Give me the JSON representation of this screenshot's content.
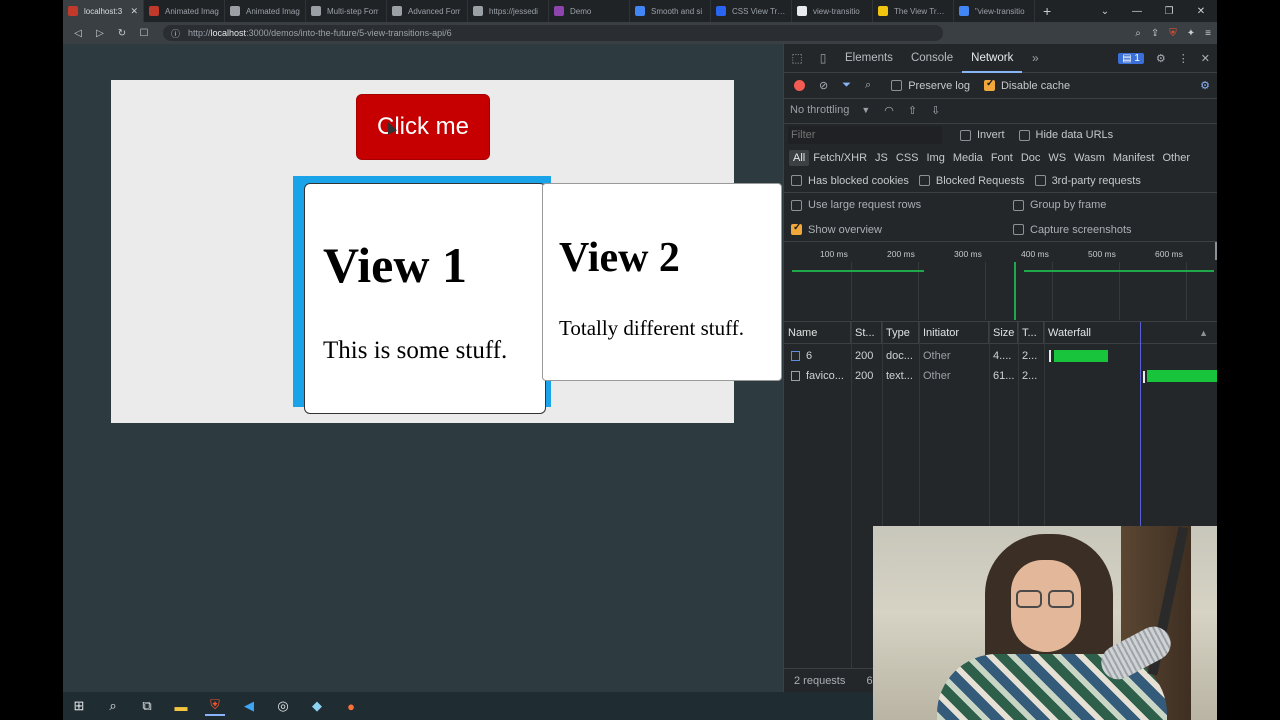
{
  "browser": {
    "tabs": [
      {
        "title": "localhost:3",
        "color": "#c0392b",
        "active": true
      },
      {
        "title": "Animated Imag",
        "color": "#c0392b"
      },
      {
        "title": "Animated Imag",
        "color": "#9aa0a6"
      },
      {
        "title": "Multi-step Forr",
        "color": "#9aa0a6"
      },
      {
        "title": "Advanced Forr",
        "color": "#9aa0a6"
      },
      {
        "title": "https://jessedi",
        "color": "#9aa0a6"
      },
      {
        "title": "Demo",
        "color": "#8e44ad"
      },
      {
        "title": "Smooth and si",
        "color": "#4285f4"
      },
      {
        "title": "CSS View Tran",
        "color": "#2965f1"
      },
      {
        "title": "view-transitio",
        "color": "#e8eaed"
      },
      {
        "title": "The View Trans",
        "color": "#f1c40f"
      },
      {
        "title": "\"view-transitio",
        "color": "#4285f4"
      }
    ],
    "url_prefix": "http://",
    "url_host": "localhost",
    "url_rest": ":3000/demos/into-the-future/5-view-transitions-api/6"
  },
  "page": {
    "button_label": "Click me",
    "view1": {
      "title": "View 1",
      "text": "This is some stuff."
    },
    "view2": {
      "title": "View 2",
      "text": "Totally different stuff."
    }
  },
  "devtools": {
    "tabs": [
      "Elements",
      "Console",
      "Network"
    ],
    "active_tab": "Network",
    "issues_count": "1",
    "preserve_log": "Preserve log",
    "disable_cache": "Disable cache",
    "throttling": "No throttling",
    "filter_placeholder": "Filter",
    "invert": "Invert",
    "hide_data_urls": "Hide data URLs",
    "types": [
      "All",
      "Fetch/XHR",
      "JS",
      "CSS",
      "Img",
      "Media",
      "Font",
      "Doc",
      "WS",
      "Wasm",
      "Manifest",
      "Other"
    ],
    "has_blocked_cookies": "Has blocked cookies",
    "blocked_requests": "Blocked Requests",
    "third_party": "3rd-party requests",
    "large_rows": "Use large request rows",
    "group_by_frame": "Group by frame",
    "show_overview": "Show overview",
    "capture_screenshots": "Capture screenshots",
    "ticks": [
      "100 ms",
      "200 ms",
      "300 ms",
      "400 ms",
      "500 ms",
      "600 ms"
    ],
    "columns": [
      "Name",
      "St...",
      "Type",
      "Initiator",
      "Size",
      "T...",
      "Waterfall"
    ],
    "rows": [
      {
        "name": "6",
        "status": "200",
        "type": "doc...",
        "initiator": "Other",
        "size": "4....",
        "time": "2..."
      },
      {
        "name": "favico...",
        "status": "200",
        "type": "text...",
        "initiator": "Other",
        "size": "61...",
        "time": "2..."
      }
    ],
    "status_requests": "2 requests",
    "status_rest": "6"
  },
  "colors": {
    "button_red": "#c60000",
    "frame_blue": "#1aa3e8",
    "accent": "#f2a73b"
  }
}
